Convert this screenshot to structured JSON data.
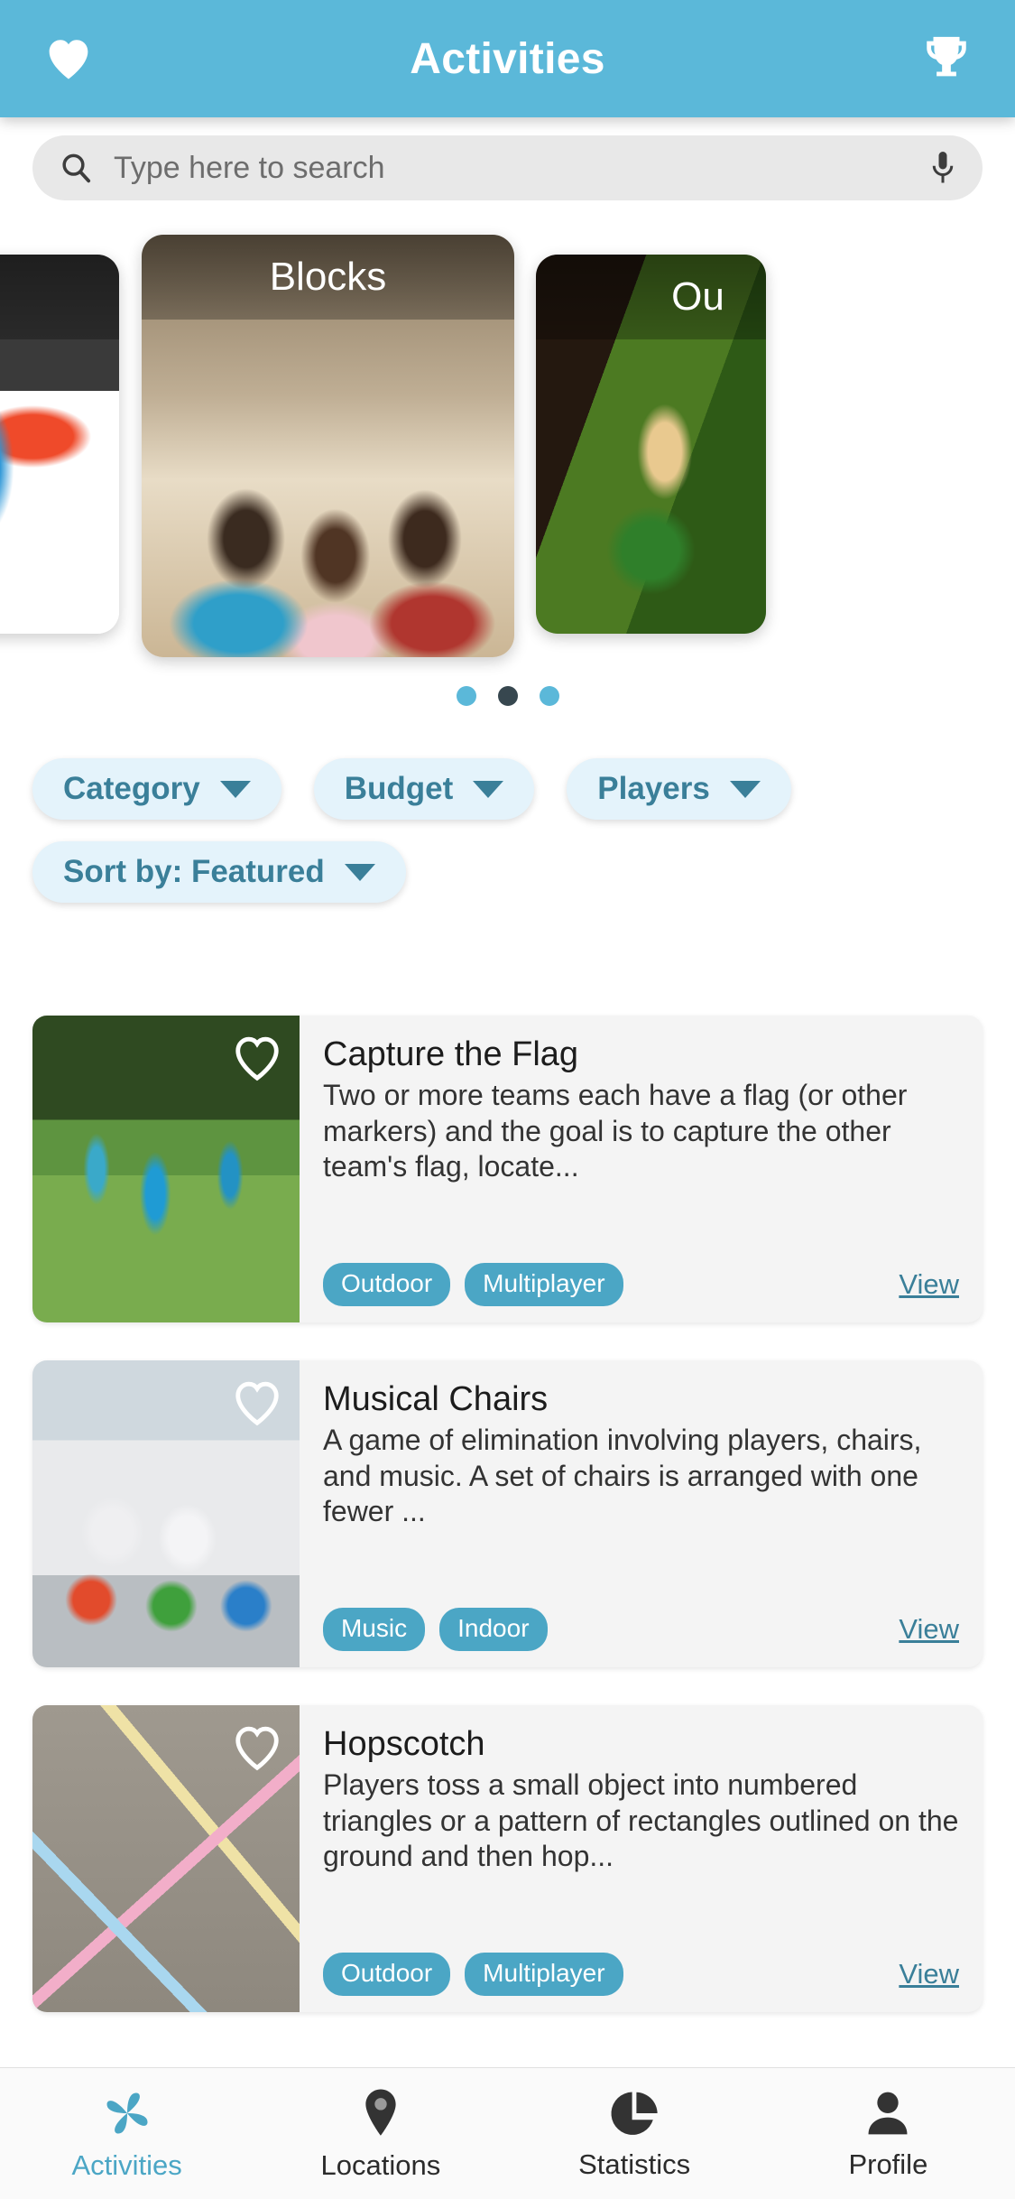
{
  "header": {
    "title": "Activities",
    "left_icon": "heart-icon",
    "right_icon": "trophy-icon",
    "bg_color": "#5bb8d9"
  },
  "search": {
    "placeholder": "Type here to search",
    "value": "",
    "search_icon": "search-icon",
    "mic_icon": "microphone-icon"
  },
  "carousel": {
    "slides": [
      {
        "caption": "",
        "position": "left"
      },
      {
        "caption": "Blocks",
        "position": "center"
      },
      {
        "caption": "Ou",
        "position": "right"
      }
    ],
    "dots": {
      "count": 3,
      "active_index": 1
    }
  },
  "filters": {
    "chips": [
      {
        "label": "Category",
        "icon": "chevron-down-icon"
      },
      {
        "label": "Budget",
        "icon": "chevron-down-icon"
      },
      {
        "label": "Players",
        "icon": "chevron-down-icon"
      },
      {
        "label": "Sort by: Featured",
        "icon": "chevron-down-icon"
      }
    ],
    "chip_text_color": "#3a7f99",
    "chip_bg_color": "#e4f3fb"
  },
  "activities": [
    {
      "title": "Capture the Flag",
      "description": "Two or more teams each have a flag (or other markers) and the goal is to capture the other team's flag, locate...",
      "tags": [
        "Outdoor",
        "Multiplayer"
      ],
      "view_label": "View",
      "favorite_icon": "heart-outline-icon"
    },
    {
      "title": "Musical Chairs",
      "description": "A game of elimination involving players, chairs, and music. A set of chairs is arranged with one fewer ...",
      "tags": [
        "Music",
        "Indoor"
      ],
      "view_label": "View",
      "favorite_icon": "heart-outline-icon"
    },
    {
      "title": "Hopscotch",
      "description": "Players toss a small object into numbered triangles or a pattern of rectangles outlined on the ground and then hop...",
      "tags": [
        "Outdoor",
        "Multiplayer"
      ],
      "view_label": "View",
      "favorite_icon": "heart-outline-icon"
    }
  ],
  "bottom_nav": {
    "active_color": "#4ba6c5",
    "items": [
      {
        "label": "Activities",
        "icon": "pinwheel-icon",
        "active": true
      },
      {
        "label": "Locations",
        "icon": "map-pin-icon",
        "active": false
      },
      {
        "label": "Statistics",
        "icon": "pie-chart-icon",
        "active": false
      },
      {
        "label": "Profile",
        "icon": "person-icon",
        "active": false
      }
    ]
  }
}
